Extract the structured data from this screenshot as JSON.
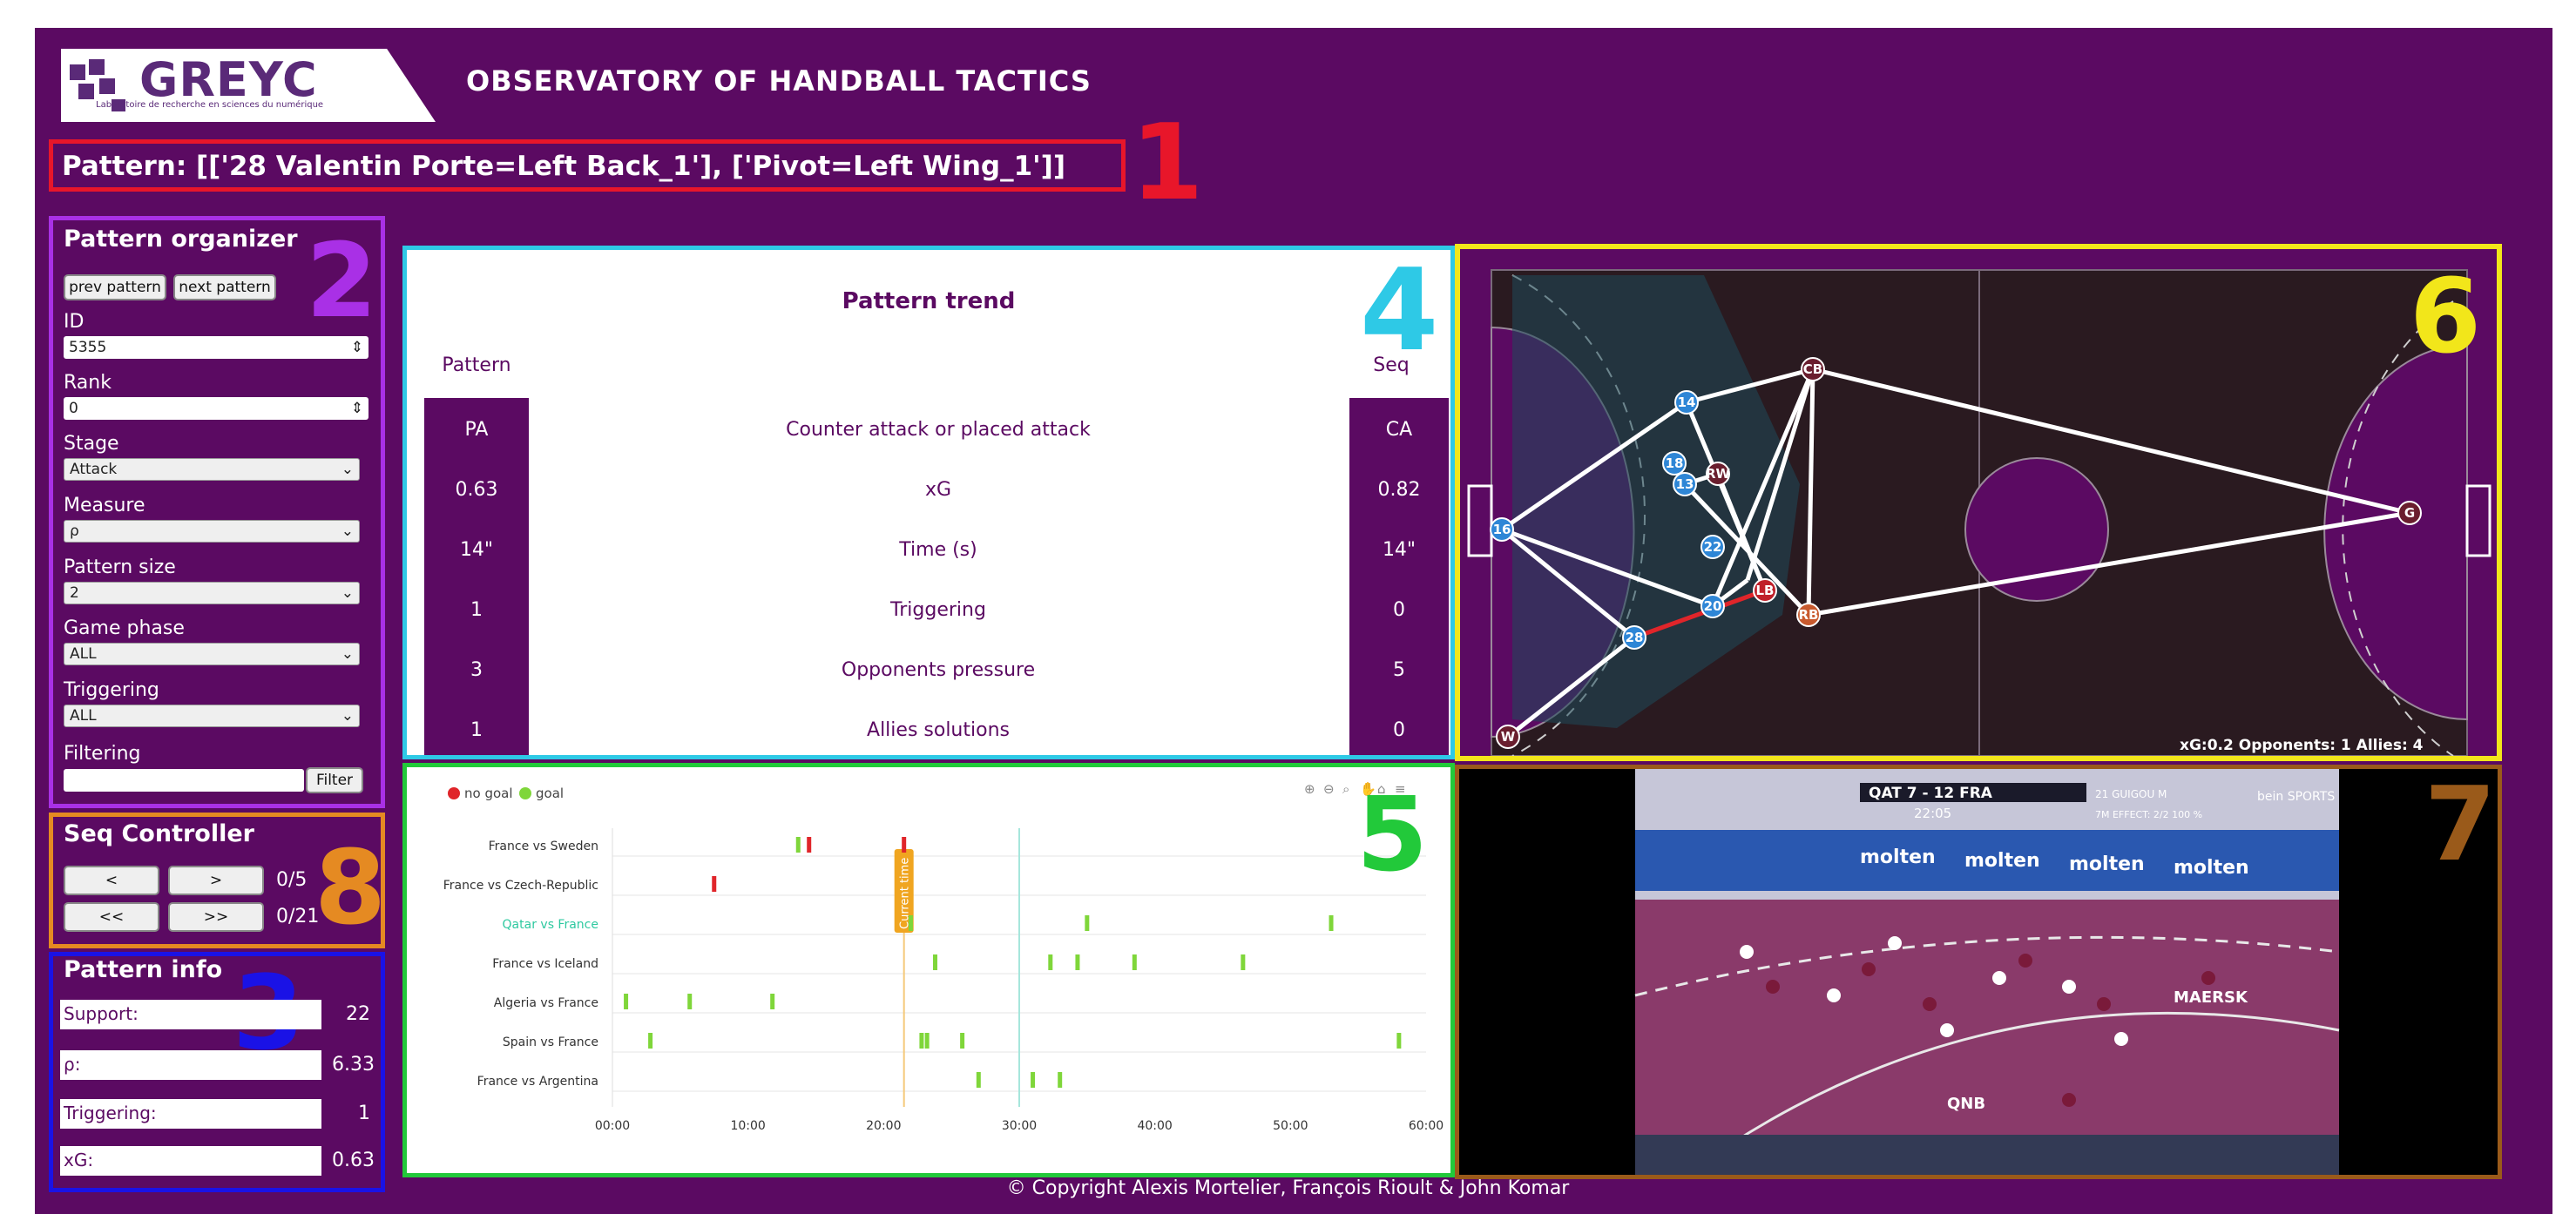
{
  "header": {
    "logo_text": "GREYC",
    "logo_subtitle": "Laboratoire de recherche en sciences du numérique",
    "title": "OBSERVATORY OF HANDBALL TACTICS",
    "pattern": "Pattern: [['28 Valentin Porte=Left Back_1'], ['Pivot=Left Wing_1']]"
  },
  "markers": {
    "m1": "1",
    "m2": "2",
    "m3": "3",
    "m4": "4",
    "m5": "5",
    "m6": "6",
    "m7": "7",
    "m8": "8"
  },
  "organizer": {
    "title": "Pattern organizer",
    "prev_label": "prev pattern",
    "next_label": "next pattern",
    "id_label": "ID",
    "id_value": "5355",
    "rank_label": "Rank",
    "rank_value": "0",
    "stage_label": "Stage",
    "stage_value": "Attack",
    "measure_label": "Measure",
    "measure_value": "ρ",
    "size_label": "Pattern size",
    "size_value": "2",
    "phase_label": "Game phase",
    "phase_value": "ALL",
    "triggering_label": "Triggering",
    "triggering_value": "ALL",
    "filtering_label": "Filtering",
    "filtering_value": "",
    "filter_button": "Filter"
  },
  "seq": {
    "title": "Seq Controller",
    "prev": "<",
    "next": ">",
    "first": "<<",
    "last": ">>",
    "counter_pattern": "0/5",
    "counter_total": "0/21"
  },
  "info": {
    "title": "Pattern info",
    "items": [
      {
        "label": "Support:",
        "value": "22"
      },
      {
        "label": "ρ:",
        "value": "6.33"
      },
      {
        "label": "Triggering:",
        "value": "1"
      },
      {
        "label": "xG:",
        "value": "0.63"
      }
    ]
  },
  "trend": {
    "title": "Pattern trend",
    "left_header": "Pattern",
    "right_header": "Seq",
    "rows": [
      {
        "left": "PA",
        "label": "Counter attack or placed attack",
        "right": "CA"
      },
      {
        "left": "0.63",
        "label": "xG",
        "right": "0.82"
      },
      {
        "left": "14\"",
        "label": "Time (s)",
        "right": "14\""
      },
      {
        "left": "1",
        "label": "Triggering",
        "right": "0"
      },
      {
        "left": "3",
        "label": "Opponents pressure",
        "right": "5"
      },
      {
        "left": "1",
        "label": "Allies solutions",
        "right": "0"
      }
    ]
  },
  "court": {
    "status": "xG:0.2 Opponents: 1 Allies: 4",
    "ally_color": "#2e86d6",
    "opp_color": "#6a1e2e",
    "allies": [
      "14",
      "18",
      "13",
      "16",
      "22",
      "20",
      "28"
    ],
    "opponents": [
      "CB",
      "RW",
      "LB",
      "G",
      "W",
      "RB"
    ]
  },
  "timeline": {
    "legend": [
      {
        "label": "no goal",
        "color": "#e0252a"
      },
      {
        "label": "goal",
        "color": "#7fd63a"
      }
    ],
    "games": [
      "France vs Sweden",
      "France vs Czech-Republic",
      "Qatar vs France",
      "France vs Iceland",
      "Algeria vs France",
      "Spain vs France",
      "France vs Argentina"
    ],
    "highlight_game": "Qatar vs France",
    "x_ticks": [
      "00:00",
      "10:00",
      "20:00",
      "30:00",
      "40:00",
      "50:00",
      "60:00"
    ],
    "current_time_label": "Current time",
    "current_time_min": 21.5,
    "events": [
      {
        "game": 0,
        "t": 14.5,
        "goal": false
      },
      {
        "game": 0,
        "t": 13.7,
        "goal": true
      },
      {
        "game": 0,
        "t": 21.5,
        "goal": false
      },
      {
        "game": 1,
        "t": 7.5,
        "goal": false
      },
      {
        "game": 2,
        "t": 22.0,
        "goal": true
      },
      {
        "game": 2,
        "t": 35.0,
        "goal": true
      },
      {
        "game": 2,
        "t": 53.0,
        "goal": true
      },
      {
        "game": 3,
        "t": 23.8,
        "goal": true
      },
      {
        "game": 3,
        "t": 32.3,
        "goal": true
      },
      {
        "game": 3,
        "t": 34.3,
        "goal": true
      },
      {
        "game": 3,
        "t": 38.5,
        "goal": true
      },
      {
        "game": 3,
        "t": 46.5,
        "goal": true
      },
      {
        "game": 4,
        "t": 1.0,
        "goal": true
      },
      {
        "game": 4,
        "t": 5.7,
        "goal": true
      },
      {
        "game": 4,
        "t": 11.8,
        "goal": true
      },
      {
        "game": 5,
        "t": 2.8,
        "goal": true
      },
      {
        "game": 5,
        "t": 22.8,
        "goal": true
      },
      {
        "game": 5,
        "t": 23.2,
        "goal": true
      },
      {
        "game": 5,
        "t": 25.8,
        "goal": true
      },
      {
        "game": 5,
        "t": 58.0,
        "goal": true
      },
      {
        "game": 6,
        "t": 27.0,
        "goal": true
      },
      {
        "game": 6,
        "t": 31.0,
        "goal": true
      },
      {
        "game": 6,
        "t": 33.0,
        "goal": true
      }
    ]
  },
  "video": {
    "score": "QAT 7 - 12 FRA",
    "clock": "22:05",
    "player_info": "21 GUIGOU M",
    "player_stat": "7M EFFECT: 2/2 100 %",
    "broadcaster": "bein SPORTS",
    "ad_text": "molten",
    "ad_text2": "QNB",
    "ad_text3": "MAERSK"
  },
  "footer": {
    "copyright": "© Copyright Alexis Mortelier, François Rioult & John Komar"
  },
  "colors": {
    "background": "#5b0a62",
    "pattern_border": "#e8162a",
    "organizer_border": "#a930e6",
    "seq_border": "#e58a22",
    "info_border": "#1a12e6",
    "trend_border": "#2ec9e6",
    "timeline_border": "#22c93a",
    "court_border": "#f2e61a",
    "video_border": "#9a5a1a"
  }
}
